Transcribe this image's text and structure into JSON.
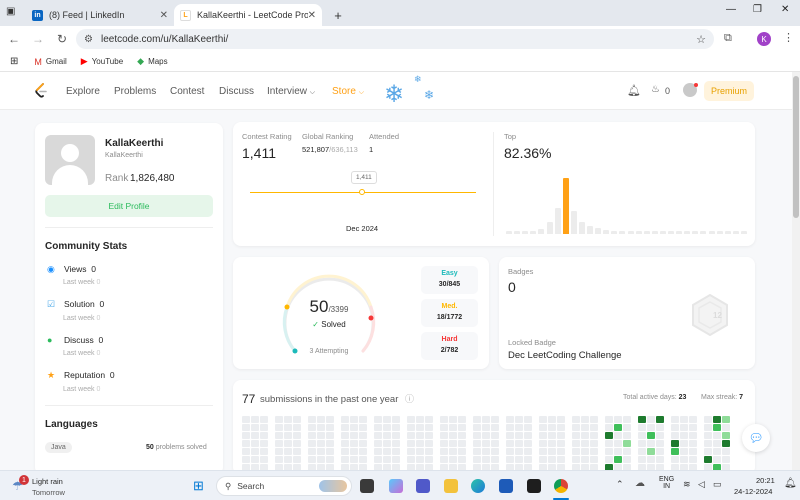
{
  "browser": {
    "tabs": [
      {
        "title": "(8) Feed | LinkedIn",
        "favicon": "linkedin-icon"
      },
      {
        "title": "KallaKeerthi - LeetCode Profile",
        "favicon": "leetcode-icon"
      }
    ],
    "url": "leetcode.com/u/KallaKeerthi/",
    "profile_initial": "K",
    "bookmarks": [
      {
        "label": "Gmail",
        "icon": "gmail-icon"
      },
      {
        "label": "YouTube",
        "icon": "youtube-icon"
      },
      {
        "label": "Maps",
        "icon": "maps-icon"
      }
    ]
  },
  "leetcode_nav": {
    "links": [
      "Explore",
      "Problems",
      "Contest",
      "Discuss",
      "Interview",
      "Store"
    ],
    "streak_count": "0",
    "premium_label": "Premium"
  },
  "profile": {
    "name": "KallaKeerthi",
    "username": "KallaKeerthi",
    "rank_label": "Rank",
    "rank": "1,826,480",
    "edit_label": "Edit Profile"
  },
  "community": {
    "heading": "Community Stats",
    "items": [
      {
        "label": "Views",
        "value": "0",
        "sub": "Last week",
        "sub_value": "0",
        "icon": "eye-icon",
        "color": "#1a90ff"
      },
      {
        "label": "Solution",
        "value": "0",
        "sub": "Last week",
        "sub_value": "0",
        "icon": "check-square-icon",
        "color": "#4aa8e8"
      },
      {
        "label": "Discuss",
        "value": "0",
        "sub": "Last week",
        "sub_value": "0",
        "icon": "chat-icon",
        "color": "#2cbb5d"
      },
      {
        "label": "Reputation",
        "value": "0",
        "sub": "Last week",
        "sub_value": "0",
        "icon": "star-icon",
        "color": "#ffa116"
      }
    ]
  },
  "languages": {
    "heading": "Languages",
    "items": [
      {
        "name": "Java",
        "count": "50",
        "suffix": "problems solved"
      }
    ]
  },
  "contest": {
    "rating_label": "Contest Rating",
    "rating": "1,411",
    "global_label": "Global Ranking",
    "global_rank": "521,807",
    "global_total": "/636,113",
    "attended_label": "Attended",
    "attended": "1",
    "point_label": "1,411",
    "date_label": "Dec 2024",
    "top_label": "Top",
    "top_value": "82.36%",
    "histogram": [
      2,
      2,
      2,
      3,
      6,
      14,
      30,
      64,
      26,
      14,
      9,
      7,
      5,
      4,
      3,
      3,
      2,
      2,
      2,
      2,
      2,
      2,
      2,
      2,
      2,
      2,
      2,
      2,
      2,
      2
    ],
    "highlight_index": 7
  },
  "solved": {
    "count": "50",
    "total": "/3399",
    "solved_label": "Solved",
    "attempting": "3 Attempting",
    "progress": 0.0147,
    "difficulties": [
      {
        "label": "Easy",
        "value": "30/845",
        "color": "#1cbaba"
      },
      {
        "label": "Med.",
        "value": "18/1772",
        "color": "#ffb700"
      },
      {
        "label": "Hard",
        "value": "2/782",
        "color": "#f63737"
      }
    ]
  },
  "badges": {
    "label": "Badges",
    "count": "0",
    "locked_label": "Locked Badge",
    "locked_name": "Dec LeetCoding Challenge",
    "badge_number": "12"
  },
  "submissions": {
    "count": "77",
    "text": "submissions in the past one year",
    "active_label": "Total active days:",
    "active_days": "23",
    "streak_label": "Max streak:",
    "max_streak": "7"
  },
  "taskbar": {
    "weather_title": "Light rain",
    "weather_sub": "Tomorrow",
    "weather_badge": "1",
    "search_placeholder": "Search",
    "lang_top": "ENG",
    "lang_bottom": "IN",
    "time": "20:21",
    "date": "24-12-2024"
  }
}
